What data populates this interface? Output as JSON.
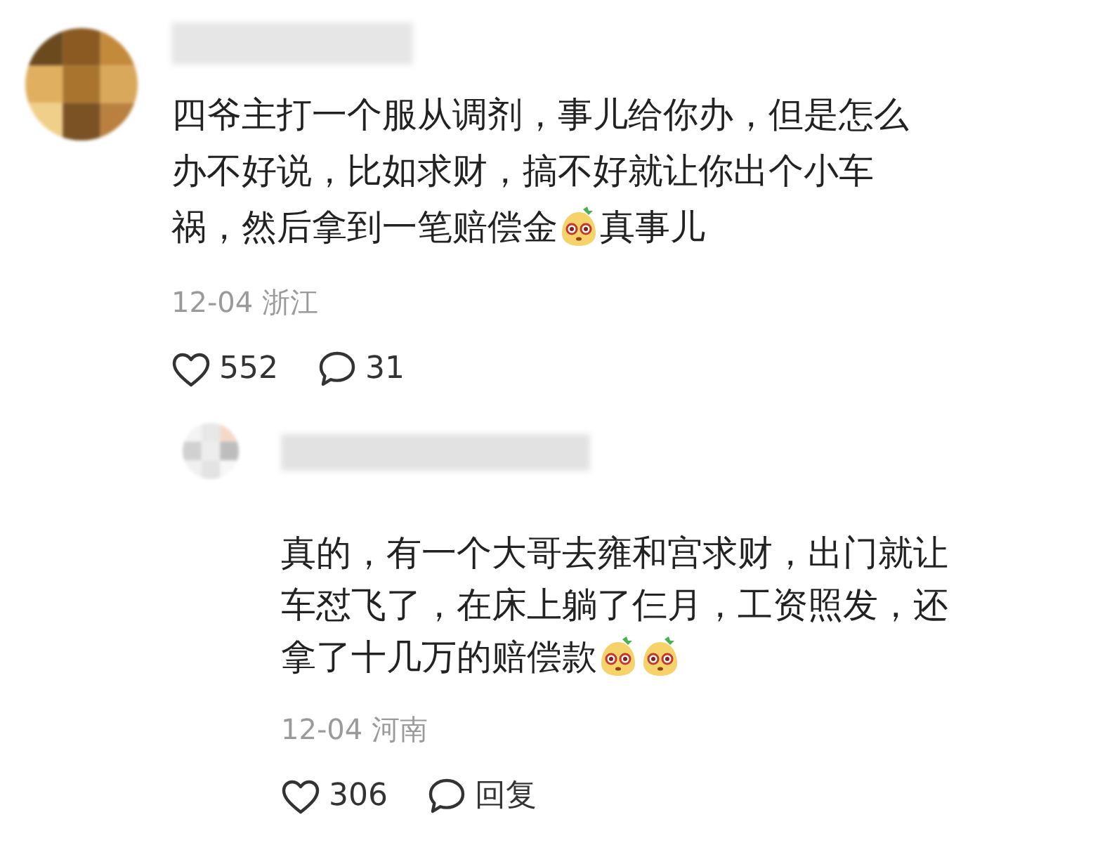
{
  "comments": [
    {
      "lines": [
        [
          {
            "kind": "text",
            "text": "四爷主打一个服从调剂，事儿给你办，但是怎么"
          }
        ],
        [
          {
            "kind": "text",
            "text": "办不好说，比如求财，搞不好就让你出个小车"
          }
        ],
        [
          {
            "kind": "text",
            "text": "祸，然后拿到一笔赔偿金"
          },
          {
            "kind": "emoji"
          },
          {
            "kind": "text",
            "text": "真事儿"
          }
        ]
      ],
      "meta": "12-04 浙江",
      "likes": "552",
      "replies": "31",
      "kind": "comment"
    },
    {
      "lines": [
        [
          {
            "kind": "text",
            "text": "真的，有一个大哥去雍和宫求财，出门就让"
          }
        ],
        [
          {
            "kind": "text",
            "text": "车怼飞了，在床上躺了仨月，工资照发，还"
          }
        ],
        [
          {
            "kind": "text",
            "text": "拿了十几万的赔偿款"
          },
          {
            "kind": "emoji"
          },
          {
            "kind": "emoji"
          }
        ]
      ],
      "meta": "12-04 河南",
      "likes": "306",
      "replies": "回复",
      "kind": "reply"
    }
  ]
}
